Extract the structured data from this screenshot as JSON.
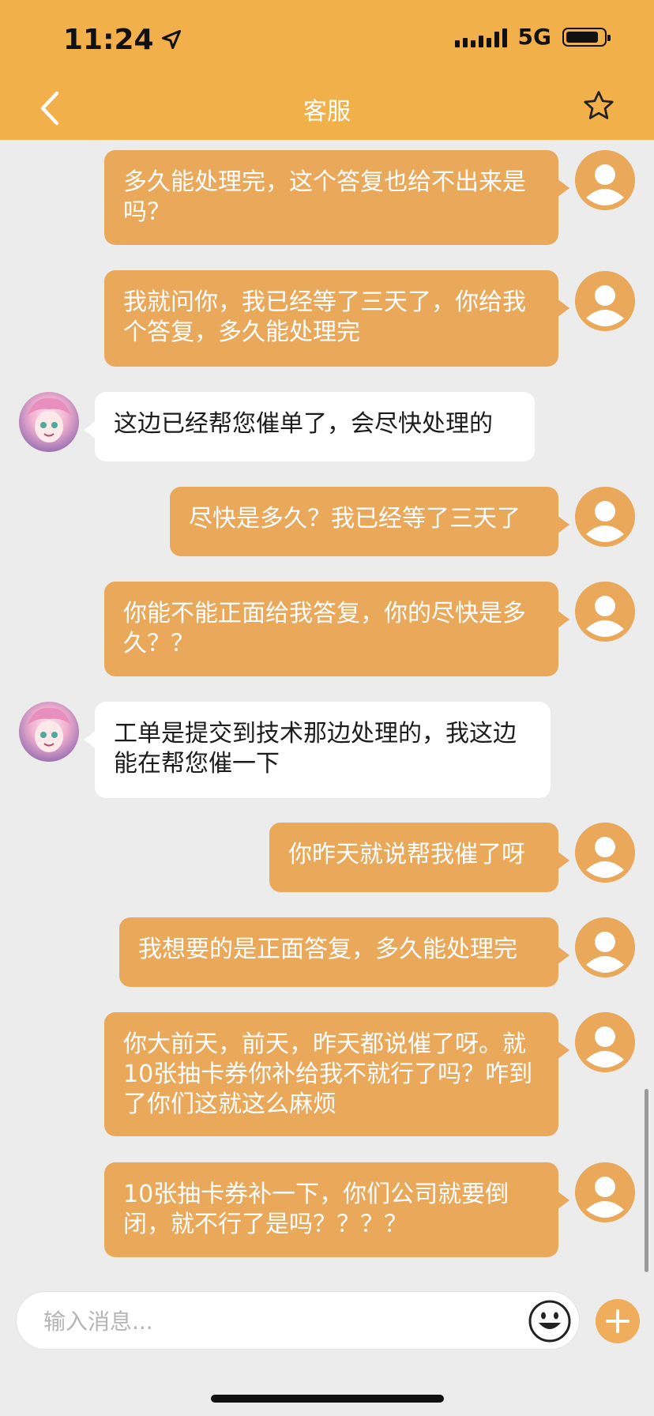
{
  "status_bar": {
    "time": "11:24",
    "network": "5G"
  },
  "header": {
    "title": "客服"
  },
  "messages": [
    {
      "side": "out",
      "text": "多久能处理完，这个答复也给不出来是吗？"
    },
    {
      "side": "out",
      "text": "我就问你，我已经等了三天了，你给我个答复，多久能处理完"
    },
    {
      "side": "in",
      "text": "这边已经帮您催单了，会尽快处理的"
    },
    {
      "side": "out",
      "text": "尽快是多久？我已经等了三天了"
    },
    {
      "side": "out",
      "text": "你能不能正面给我答复，你的尽快是多久？？"
    },
    {
      "side": "in",
      "text": "工单是提交到技术那边处理的，我这边能在帮您催一下"
    },
    {
      "side": "out",
      "text": "你昨天就说帮我催了呀"
    },
    {
      "side": "out",
      "text": "我想要的是正面答复，多久能处理完"
    },
    {
      "side": "out",
      "text": "你大前天，前天，昨天都说催了呀。就10张抽卡券你补给我不就行了吗？咋到了你们这就这么麻烦"
    },
    {
      "side": "out",
      "text": "10张抽卡券补一下，你们公司就要倒闭，就不行了是吗？？？？"
    }
  ],
  "composer": {
    "placeholder": "输入消息..."
  },
  "colors": {
    "header": "#f2b04a",
    "bubble_out": "#e9a85a",
    "background": "#ececec"
  }
}
